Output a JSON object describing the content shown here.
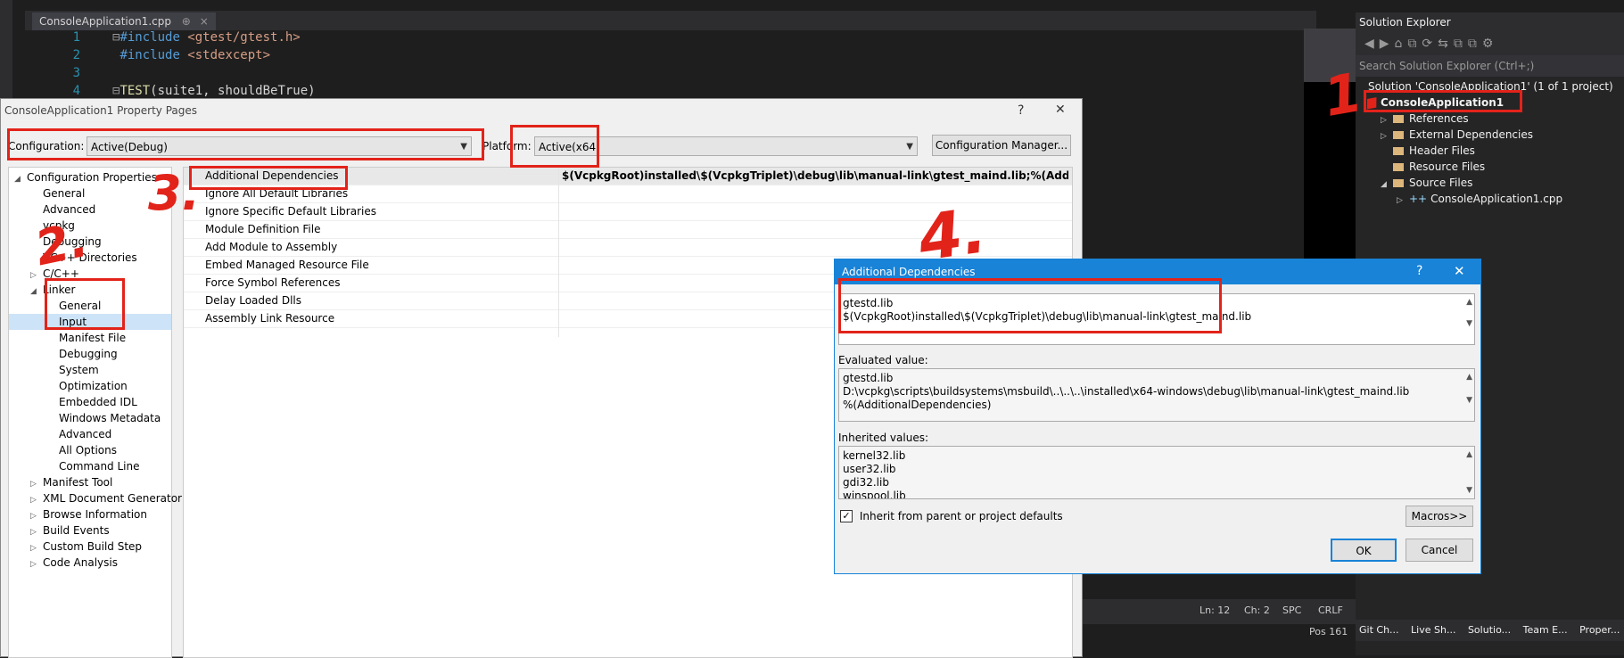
{
  "editor": {
    "tab_label": "ConsoleApplication1.cpp",
    "tab_pin": "⊕",
    "tab_close": "×",
    "lines": [
      {
        "num": "1",
        "prefix": "⊟",
        "kw": "#include",
        "rest": " <gtest/gtest.h>"
      },
      {
        "num": "2",
        "prefix": " ",
        "kw": "#include",
        "rest": " <stdexcept>"
      },
      {
        "num": "3",
        "prefix": " ",
        "kw": "",
        "rest": ""
      },
      {
        "num": "4",
        "prefix": "⊟",
        "kw": "TEST",
        "rest": "(suite1, shouldBeTrue)"
      }
    ]
  },
  "solution_explorer": {
    "title": "Solution Explorer",
    "search_placeholder": "Search Solution Explorer (Ctrl+;)",
    "solution_label": "Solution 'ConsoleApplication1' (1 of 1 project)",
    "project": "ConsoleApplication1",
    "items": [
      {
        "label": "References",
        "expander": "▷",
        "indent": 1
      },
      {
        "label": "External Dependencies",
        "expander": "▷",
        "indent": 1
      },
      {
        "label": "Header Files",
        "expander": "",
        "indent": 1
      },
      {
        "label": "Resource Files",
        "expander": "",
        "indent": 1
      },
      {
        "label": "Source Files",
        "expander": "◢",
        "indent": 1
      },
      {
        "label": "ConsoleApplication1.cpp",
        "expander": "▷",
        "indent": 2
      }
    ],
    "bottom_tabs": [
      "Git Ch...",
      "Live Sh...",
      "Solutio...",
      "Team E...",
      "Proper..."
    ]
  },
  "status": {
    "ln": "Ln: 12",
    "ch": "Ch: 2",
    "spc": "SPC",
    "crlf": "CRLF",
    "pos": "Pos 161"
  },
  "property_pages": {
    "title": "ConsoleApplication1 Property Pages",
    "help": "?",
    "close": "✕",
    "configuration_label": "Configuration:",
    "configuration_value": "Active(Debug)",
    "platform_label": "Platform:",
    "platform_value": "Active(x64)",
    "config_manager": "Configuration Manager...",
    "tree": [
      {
        "label": "Configuration Properties",
        "level": 0,
        "exp": "◢"
      },
      {
        "label": "General",
        "level": 1,
        "exp": ""
      },
      {
        "label": "Advanced",
        "level": 1,
        "exp": ""
      },
      {
        "label": "vcpkg",
        "level": 1,
        "exp": ""
      },
      {
        "label": "Debugging",
        "level": 1,
        "exp": ""
      },
      {
        "label": "VC++ Directories",
        "level": 1,
        "exp": ""
      },
      {
        "label": "C/C++",
        "level": 1,
        "exp": "▷"
      },
      {
        "label": "Linker",
        "level": 1,
        "exp": "◢"
      },
      {
        "label": "General",
        "level": 2,
        "exp": ""
      },
      {
        "label": "Input",
        "level": 2,
        "exp": "",
        "selected": true
      },
      {
        "label": "Manifest File",
        "level": 2,
        "exp": ""
      },
      {
        "label": "Debugging",
        "level": 2,
        "exp": ""
      },
      {
        "label": "System",
        "level": 2,
        "exp": ""
      },
      {
        "label": "Optimization",
        "level": 2,
        "exp": ""
      },
      {
        "label": "Embedded IDL",
        "level": 2,
        "exp": ""
      },
      {
        "label": "Windows Metadata",
        "level": 2,
        "exp": ""
      },
      {
        "label": "Advanced",
        "level": 2,
        "exp": ""
      },
      {
        "label": "All Options",
        "level": 2,
        "exp": ""
      },
      {
        "label": "Command Line",
        "level": 2,
        "exp": ""
      },
      {
        "label": "Manifest Tool",
        "level": 1,
        "exp": "▷"
      },
      {
        "label": "XML Document Generator",
        "level": 1,
        "exp": "▷"
      },
      {
        "label": "Browse Information",
        "level": 1,
        "exp": "▷"
      },
      {
        "label": "Build Events",
        "level": 1,
        "exp": "▷"
      },
      {
        "label": "Custom Build Step",
        "level": 1,
        "exp": "▷"
      },
      {
        "label": "Code Analysis",
        "level": 1,
        "exp": "▷"
      }
    ],
    "properties": [
      {
        "name": "Additional Dependencies",
        "value": "$(VcpkgRoot)installed\\$(VcpkgTriplet)\\debug\\lib\\manual-link\\gtest_maind.lib;%(AdditionalDependencies)"
      },
      {
        "name": "Ignore All Default Libraries",
        "value": ""
      },
      {
        "name": "Ignore Specific Default Libraries",
        "value": ""
      },
      {
        "name": "Module Definition File",
        "value": ""
      },
      {
        "name": "Add Module to Assembly",
        "value": ""
      },
      {
        "name": "Embed Managed Resource File",
        "value": ""
      },
      {
        "name": "Force Symbol References",
        "value": ""
      },
      {
        "name": "Delay Loaded Dlls",
        "value": ""
      },
      {
        "name": "Assembly Link Resource",
        "value": ""
      }
    ]
  },
  "add_deps": {
    "title": "Additional Dependencies",
    "help": "?",
    "close": "✕",
    "edit_lines": [
      "gtestd.lib",
      "$(VcpkgRoot)installed\\$(VcpkgTriplet)\\debug\\lib\\manual-link\\gtest_maind.lib"
    ],
    "evaluated_label": "Evaluated value:",
    "evaluated_lines": [
      "gtestd.lib",
      "D:\\vcpkg\\scripts\\buildsystems\\msbuild\\..\\..\\..\\installed\\x64-windows\\debug\\lib\\manual-link\\gtest_maind.lib",
      "%(AdditionalDependencies)"
    ],
    "inherited_label": "Inherited values:",
    "inherited_lines": [
      "kernel32.lib",
      "user32.lib",
      "gdi32.lib",
      "winspool.lib"
    ],
    "inherit_checkbox": "Inherit from parent or project defaults",
    "macros": "Macros>>",
    "ok": "OK",
    "cancel": "Cancel"
  },
  "annotations": {
    "n1": "1.",
    "n2": "2.",
    "n3": "3.",
    "n4": "4."
  },
  "colors": {
    "annotation_red": "#e2231a",
    "dialog_title_blue": "#1883d7",
    "vs_dark": "#1e1e1e"
  }
}
